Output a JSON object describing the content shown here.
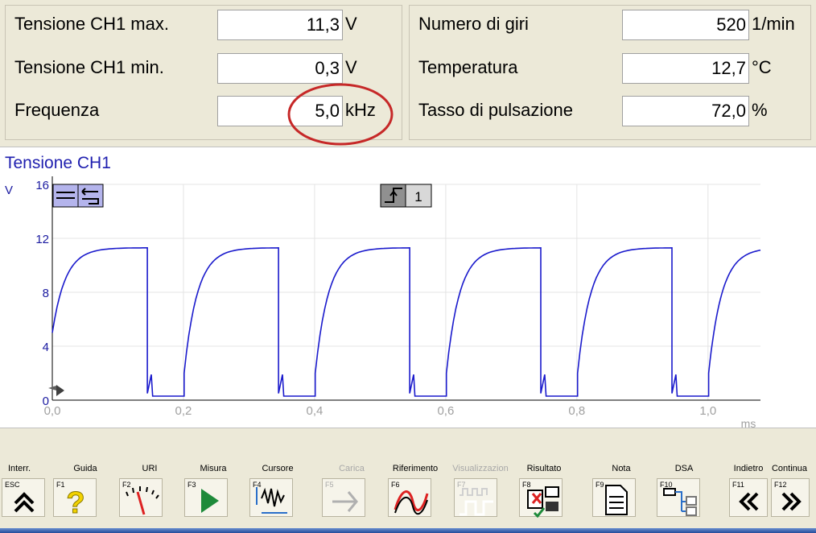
{
  "measurements": {
    "left": [
      {
        "label": "Tensione CH1 max.",
        "value": "11,3",
        "unit": "V"
      },
      {
        "label": "Tensione CH1 min.",
        "value": "0,3",
        "unit": "V"
      },
      {
        "label": "Frequenza",
        "value": "5,0",
        "unit": "kHz"
      }
    ],
    "right": [
      {
        "label": "Numero di giri",
        "value": "520",
        "unit": "1/min"
      },
      {
        "label": "Temperatura",
        "value": "12,7",
        "unit": "°C"
      },
      {
        "label": "Tasso di pulsazione",
        "value": "72,0",
        "unit": "%"
      }
    ]
  },
  "chart_data": {
    "type": "line",
    "title": "Tensione CH1",
    "ylabel": "V",
    "xlabel": "ms",
    "xlim": [
      0,
      1.08
    ],
    "ylim": [
      0,
      16
    ],
    "x_ticks": [
      "0,0",
      "0,2",
      "0,4",
      "0,6",
      "0,8",
      "1,0"
    ],
    "y_ticks": [
      "0",
      "4",
      "8",
      "12",
      "16"
    ],
    "trigger_channel": "1",
    "grid": true,
    "series": [
      {
        "color": "#1a1acc",
        "period_ms": 0.2,
        "max_v": 11.3,
        "min_v": 0.3,
        "duty_high": 0.72,
        "first_fall_ms": 0.145
      }
    ]
  },
  "toolbar": {
    "buttons": [
      {
        "label": "Interr.",
        "fkey": "ESC",
        "icon": "double-chevron-up-icon",
        "enabled": true
      },
      {
        "label": "Guida",
        "fkey": "F1",
        "icon": "question-icon",
        "enabled": true
      },
      {
        "label": "URI",
        "fkey": "F2",
        "icon": "gauge-icon",
        "enabled": true
      },
      {
        "label": "Misura",
        "fkey": "F3",
        "icon": "play-icon",
        "enabled": true
      },
      {
        "label": "Cursore",
        "fkey": "F4",
        "icon": "cursor-waveform-icon",
        "enabled": true
      },
      {
        "label": "Carica",
        "fkey": "F5",
        "icon": "load-arrows-icon",
        "enabled": false
      },
      {
        "label": "Riferimento",
        "fkey": "F6",
        "icon": "reference-curve-icon",
        "enabled": true
      },
      {
        "label": "Visualizzazion",
        "fkey": "F7",
        "icon": "square-wave-icon",
        "enabled": false
      },
      {
        "label": "Risultato",
        "fkey": "F8",
        "icon": "result-print-icon",
        "enabled": true
      },
      {
        "label": "Nota",
        "fkey": "F9",
        "icon": "note-icon",
        "enabled": true
      },
      {
        "label": "DSA",
        "fkey": "F10",
        "icon": "dsa-tree-icon",
        "enabled": true
      },
      {
        "label": "Indietro",
        "fkey": "F11",
        "icon": "double-chevron-left-icon",
        "enabled": true
      },
      {
        "label": "Continua",
        "fkey": "F12",
        "icon": "double-chevron-right-icon",
        "enabled": true
      }
    ]
  }
}
